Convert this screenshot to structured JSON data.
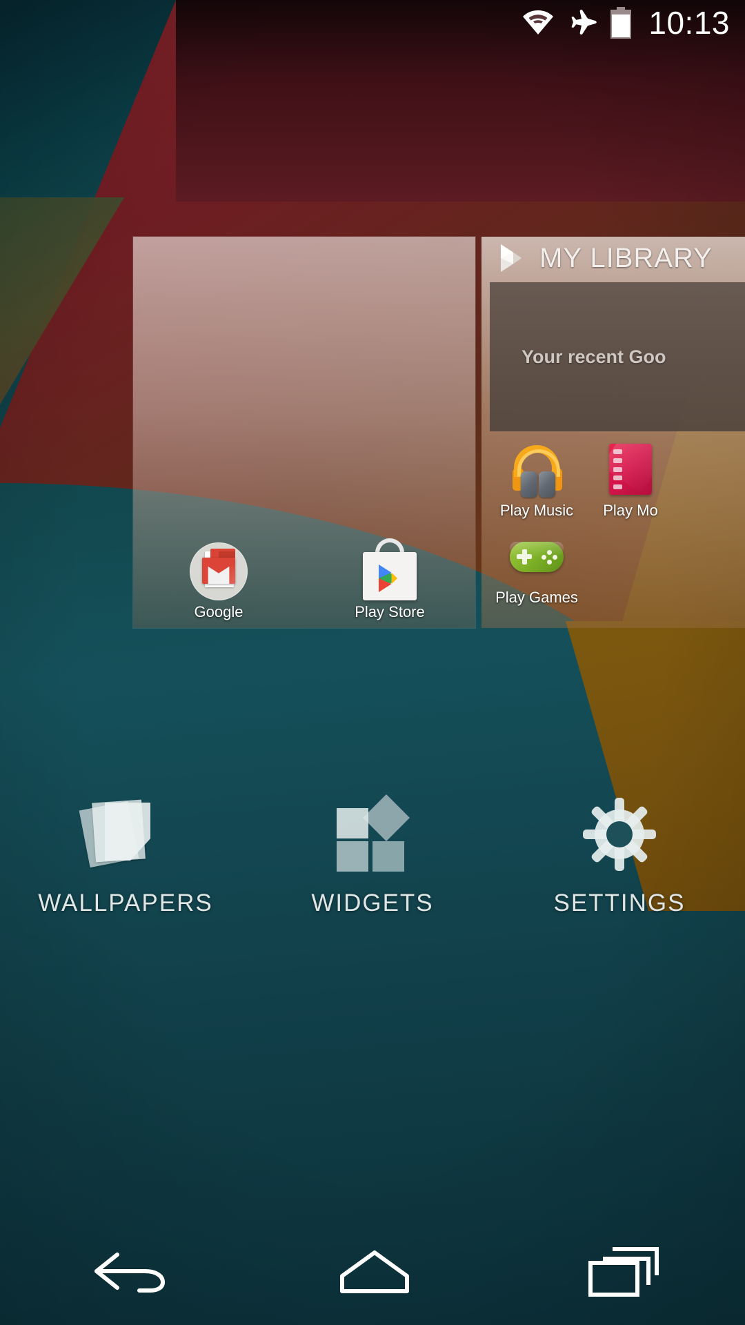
{
  "status_bar": {
    "time": "10:13",
    "icons": [
      {
        "name": "wifi-icon",
        "label": "Wi-Fi"
      },
      {
        "name": "airplane-mode-icon",
        "label": "Airplane mode"
      },
      {
        "name": "battery-icon",
        "label": "Battery",
        "level_percent": 85
      }
    ]
  },
  "home_preview": {
    "icons": [
      {
        "name": "google-folder-icon",
        "label": "Google"
      },
      {
        "name": "play-store-icon",
        "label": "Play Store"
      }
    ]
  },
  "play_widget": {
    "title": "MY LIBRARY",
    "icon": "play-triangle-icon",
    "empty_text": "Your recent Goo",
    "apps": [
      {
        "name": "play-music-icon",
        "label": "Play Music"
      },
      {
        "name": "play-movies-icon",
        "label": "Play Mo"
      },
      {
        "name": "play-games-icon",
        "label": "Play Games"
      }
    ]
  },
  "edit_actions": [
    {
      "name": "wallpapers-action",
      "label": "WALLPAPERS",
      "icon": "wallpaper-stack-icon"
    },
    {
      "name": "widgets-action",
      "label": "WIDGETS",
      "icon": "widgets-blocks-icon"
    },
    {
      "name": "settings-action",
      "label": "SETTINGS",
      "icon": "gear-icon"
    }
  ],
  "nav_bar": [
    {
      "name": "back-button",
      "icon": "back-arrow-icon"
    },
    {
      "name": "home-button",
      "icon": "home-icon"
    },
    {
      "name": "recents-button",
      "icon": "recents-icon"
    }
  ],
  "colors": {
    "status_text": "#ffffff",
    "accent_teal": "#12474e",
    "accent_red": "#6e1d22",
    "accent_olive": "#7a5512",
    "action_label": "#dfe6e6"
  }
}
